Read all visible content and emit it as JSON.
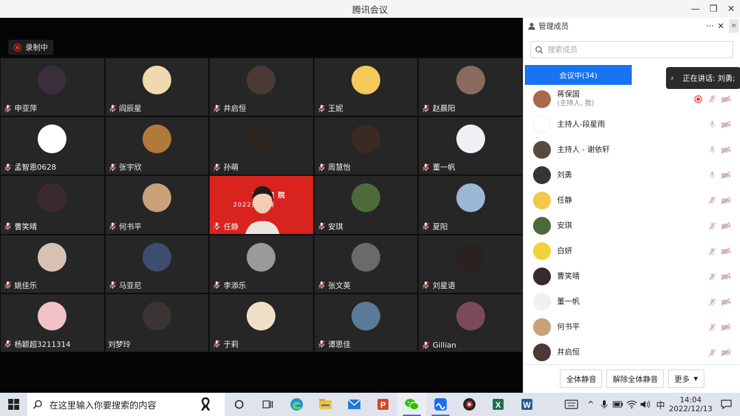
{
  "window": {
    "title": "腾讯会议"
  },
  "recording": {
    "label": "录制中"
  },
  "participants_grid": [
    {
      "name": "申亚萍",
      "avatar": "#3a2e3a"
    },
    {
      "name": "阎辰星",
      "avatar": "#f0d9b0"
    },
    {
      "name": "井启恒",
      "avatar": "#4a3a36"
    },
    {
      "name": "王妮",
      "avatar": "#f4c95a"
    },
    {
      "name": "赵晨阳",
      "avatar": "#8a6a5e"
    },
    {
      "name": "孟智恩0628",
      "avatar": "#ffffff"
    },
    {
      "name": "张宇欣",
      "avatar": "#b07a3a"
    },
    {
      "name": "孙萌",
      "avatar": "#2b2622"
    },
    {
      "name": "周慧怡",
      "avatar": "#3a2a24"
    },
    {
      "name": "董一帆",
      "avatar": "#eef0f4"
    },
    {
      "name": "曹笑晴",
      "avatar": "#3a2a30"
    },
    {
      "name": "何书平",
      "avatar": "#c9a27a"
    },
    {
      "name": "任静",
      "avatar": "",
      "video": true
    },
    {
      "name": "安琪",
      "avatar": "#4d6a3a"
    },
    {
      "name": "夏阳",
      "avatar": "#9ab8d6"
    },
    {
      "name": "姚佳乐",
      "avatar": "#d8c2b6"
    },
    {
      "name": "马亚尼",
      "avatar": "#3c4d6e"
    },
    {
      "name": "李添乐",
      "avatar": "#9a9a9a"
    },
    {
      "name": "张文英",
      "avatar": "#6a6a6a"
    },
    {
      "name": "刘星语",
      "avatar": "#2a2220"
    },
    {
      "name": "杨颖超3211314",
      "avatar": "#f2c2c8"
    },
    {
      "name": "刘梦玲",
      "avatar": "#3a3432",
      "nomic": true
    },
    {
      "name": "于莉",
      "avatar": "#f0e0c8"
    },
    {
      "name": "谭思佳",
      "avatar": "#5a7a9a"
    },
    {
      "name": "Gillian",
      "avatar": "#7a4a5a"
    }
  ],
  "video_banner": {
    "line1": "高等职  院",
    "line2": "2022英    大赛"
  },
  "panel": {
    "title": "管理成员",
    "more_icon": "···",
    "search_placeholder": "搜索成员",
    "tab_in_meeting": "会议中(34)",
    "speaking": "正在讲话: 刘勇;",
    "members": [
      {
        "name": "蒋保国",
        "sub": "(主持人, 我)",
        "avatar": "#a86a4a",
        "rec": true,
        "mic": "muted",
        "cam": "off"
      },
      {
        "name": "主持人-段星雨",
        "sub": "",
        "avatar": "#ffffff",
        "rec": false,
        "mic": "on",
        "cam": "off"
      },
      {
        "name": "主持人 - 谢依轩",
        "sub": "",
        "avatar": "#5a4a3e",
        "rec": false,
        "mic": "on",
        "cam": "off"
      },
      {
        "name": "刘勇",
        "sub": "",
        "avatar": "#3a3234",
        "rec": false,
        "mic": "on",
        "cam": "off"
      },
      {
        "name": "任静",
        "sub": "",
        "avatar": "#f2c84a",
        "rec": false,
        "mic": "muted",
        "cam": "off"
      },
      {
        "name": "安琪",
        "sub": "",
        "avatar": "#4d6a3a",
        "rec": false,
        "mic": "muted",
        "cam": "off"
      },
      {
        "name": "白妍",
        "sub": "",
        "avatar": "#f0d23a",
        "rec": false,
        "mic": "muted",
        "cam": "off"
      },
      {
        "name": "曹笑晴",
        "sub": "",
        "avatar": "#3a2a30",
        "rec": false,
        "mic": "muted",
        "cam": "off"
      },
      {
        "name": "董一帆",
        "sub": "",
        "avatar": "#eef0f4",
        "rec": false,
        "mic": "muted",
        "cam": "off"
      },
      {
        "name": "何书平",
        "sub": "",
        "avatar": "#c9a27a",
        "rec": false,
        "mic": "muted",
        "cam": "off"
      },
      {
        "name": "井启恒",
        "sub": "",
        "avatar": "#4a3a36",
        "rec": false,
        "mic": "muted",
        "cam": "off"
      }
    ],
    "footer": {
      "mute_all": "全体静音",
      "unmute_all": "解除全体静音",
      "more": "更多"
    }
  },
  "taskbar": {
    "search_text": "在这里输入你要搜索的内容",
    "ime": "中",
    "time": "14:04",
    "date": "2022/12/13"
  }
}
